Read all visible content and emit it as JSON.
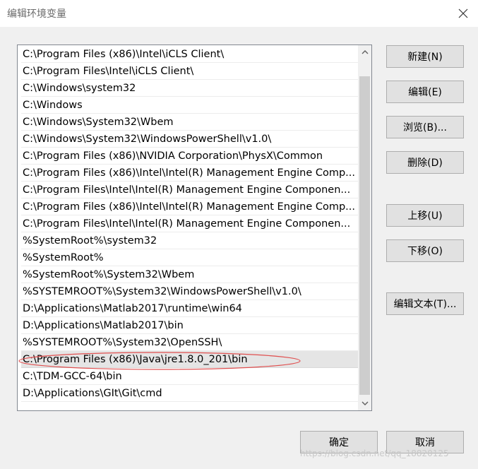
{
  "window": {
    "title": "编辑环境变量"
  },
  "path_list": {
    "items": [
      "C:\\Program Files (x86)\\Intel\\iCLS Client\\",
      "C:\\Program Files\\Intel\\iCLS Client\\",
      "C:\\Windows\\system32",
      "C:\\Windows",
      "C:\\Windows\\System32\\Wbem",
      "C:\\Windows\\System32\\WindowsPowerShell\\v1.0\\",
      "C:\\Program Files (x86)\\NVIDIA Corporation\\PhysX\\Common",
      "C:\\Program Files (x86)\\Intel\\Intel(R) Management Engine Comp...",
      "C:\\Program Files\\Intel\\Intel(R) Management Engine Componen...",
      "C:\\Program Files (x86)\\Intel\\Intel(R) Management Engine Comp...",
      "C:\\Program Files\\Intel\\Intel(R) Management Engine Componen...",
      "%SystemRoot%\\system32",
      "%SystemRoot%",
      "%SystemRoot%\\System32\\Wbem",
      "%SYSTEMROOT%\\System32\\WindowsPowerShell\\v1.0\\",
      "D:\\Applications\\Matlab2017\\runtime\\win64",
      "D:\\Applications\\Matlab2017\\bin",
      "%SYSTEMROOT%\\System32\\OpenSSH\\",
      "C:\\Program Files (x86)\\Java\\jre1.8.0_201\\bin",
      "C:\\TDM-GCC-64\\bin",
      "D:\\Applications\\GIt\\Git\\cmd"
    ],
    "selected_index": 18
  },
  "buttons": {
    "new": "新建(N)",
    "edit": "编辑(E)",
    "browse": "浏览(B)...",
    "delete": "删除(D)",
    "move_up": "上移(U)",
    "move_down": "下移(O)",
    "edit_text": "编辑文本(T)...",
    "ok": "确定",
    "cancel": "取消"
  },
  "watermark": "https://blog.csdn.net/qq_18820125",
  "colors": {
    "annotation_ellipse": "#e05050"
  }
}
